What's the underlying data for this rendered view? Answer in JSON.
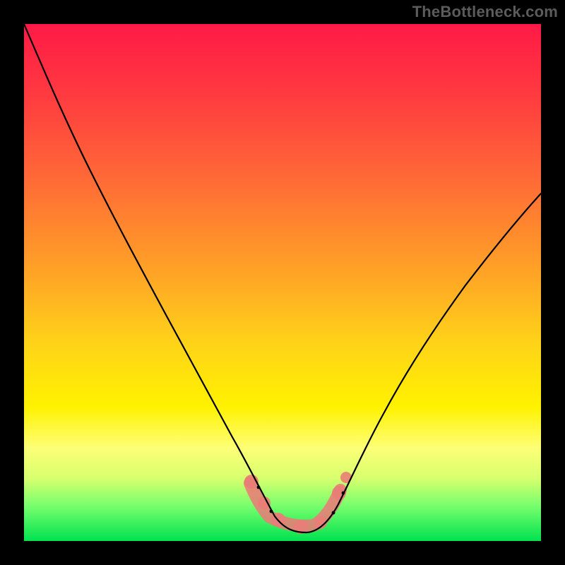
{
  "watermark": "TheBottleneck.com",
  "colors": {
    "gradient_top": "#ff1a46",
    "gradient_mid1": "#ff6a36",
    "gradient_mid2": "#ffd418",
    "gradient_mid3": "#fdff76",
    "gradient_bottom": "#00e24f",
    "curve": "#000000",
    "valley_marker": "#e97c77",
    "frame": "#000000"
  },
  "chart_data": {
    "type": "line",
    "title": "",
    "xlabel": "",
    "ylabel": "",
    "xlim": [
      0,
      100
    ],
    "ylim": [
      0,
      100
    ],
    "grid": false,
    "legend": false,
    "x": [
      0,
      5,
      10,
      15,
      20,
      25,
      30,
      35,
      40,
      42,
      44,
      46,
      48,
      50,
      52,
      54,
      56,
      58,
      60,
      62,
      65,
      70,
      75,
      80,
      85,
      90,
      95,
      100
    ],
    "series": [
      {
        "name": "bottleneck-curve",
        "values": [
          100,
          88,
          76,
          66,
          56,
          47,
          38,
          30,
          22,
          18,
          13,
          9,
          6,
          4,
          3,
          3,
          4,
          6,
          9,
          13,
          18,
          27,
          35,
          43,
          50,
          56,
          62,
          67
        ]
      }
    ],
    "annotations": [
      {
        "type": "valley-highlight",
        "x_range": [
          44,
          60
        ],
        "y_level": 4
      }
    ]
  }
}
